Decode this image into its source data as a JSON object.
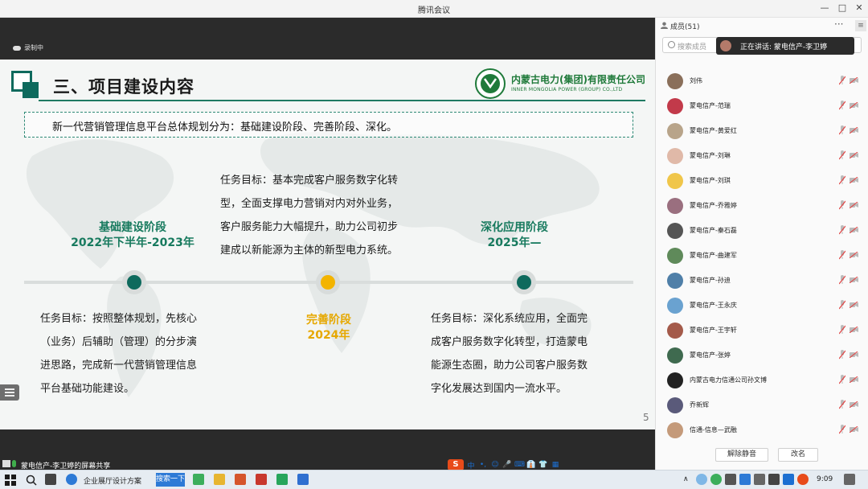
{
  "window": {
    "title": "腾讯会议",
    "controls": [
      "—",
      "□",
      "✕"
    ]
  },
  "recording": {
    "label": "录制中",
    "icon": "cloud-recording-icon"
  },
  "slide": {
    "section_title": "三、项目建设内容",
    "company_cn": "内蒙古电力(集团)有限责任公司",
    "company_en": "INNER MONGOLIA POWER (GROUP) CO.,LTD",
    "summary": "新一代营销管理信息平台总体规划分为：基础建设阶段、完善阶段、深化。",
    "stages": [
      {
        "name": "基础建设阶段",
        "period": "2022年下半年-2023年",
        "color": "#177a5e"
      },
      {
        "name": "完善阶段",
        "period": "2024年",
        "color": "#e6a800"
      },
      {
        "name": "深化应用阶段",
        "period": "2025年—",
        "color": "#177a5e"
      }
    ],
    "tasks": [
      {
        "lines": [
          "任务目标：按照整体规划，先核心",
          "（业务）后辅助（管理）的分步演",
          "进思路，完成新一代营销管理信息",
          "平台基础功能建设。"
        ]
      },
      {
        "lines": [
          "任务目标：基本完成客户服务数字化转",
          "型，全面支撑电力营销对内对外业务，",
          "客户服务能力大幅提升，助力公司初步",
          "建成以新能源为主体的新型电力系统。"
        ]
      },
      {
        "lines": [
          "任务目标：深化系统应用，全面完",
          "成客户服务数字化转型，打造蒙电",
          "能源生态圈，助力公司客户服务数",
          "字化发展达到国内一流水平。"
        ]
      }
    ],
    "page_number": "5"
  },
  "members_panel": {
    "title": "成员(51)",
    "more": "···",
    "search_placeholder": "搜索成员",
    "speaking_label": "正在讲话: 蒙电信产-李卫婷",
    "members": [
      {
        "name": "刘伟",
        "avatar_color": "#8a6f5a"
      },
      {
        "name": "蒙电信产-范瑞",
        "avatar_color": "#c23a4a"
      },
      {
        "name": "蒙电信产-黄爱红",
        "avatar_color": "#b8a48a"
      },
      {
        "name": "蒙电信产-刘琳",
        "avatar_color": "#e0b9a8"
      },
      {
        "name": "蒙电信产-刘琪",
        "avatar_color": "#f0c64a"
      },
      {
        "name": "蒙电信产-乔雅婷",
        "avatar_color": "#9a6f7f"
      },
      {
        "name": "蒙电信产-秦石磊",
        "avatar_color": "#555555"
      },
      {
        "name": "蒙电信产-曲建军",
        "avatar_color": "#5f8a5a"
      },
      {
        "name": "蒙电信产-孙迪",
        "avatar_color": "#4f7fa8"
      },
      {
        "name": "蒙电信产-王永庆",
        "avatar_color": "#6aa2d0"
      },
      {
        "name": "蒙电信产-王宇轩",
        "avatar_color": "#a45a4a"
      },
      {
        "name": "蒙电信产-张婷",
        "avatar_color": "#3f6a4f"
      },
      {
        "name": "内蒙古电力信通公司孙文博",
        "avatar_color": "#222222"
      },
      {
        "name": "乔新辉",
        "avatar_color": "#5a5a7a"
      },
      {
        "name": "信通-信息—武融",
        "avatar_color": "#c49a7a"
      }
    ],
    "mute_all": "解除静音",
    "rename": "改名"
  },
  "share_caption": "蒙电信产-李卫婷的屏幕共享",
  "ime_letter": "S",
  "ime_icons": [
    "中",
    "•,",
    "☺",
    "🎤",
    "⌨",
    "👔",
    "👕",
    "▦"
  ],
  "taskbar": {
    "browser_tab": "企业展厅设计方案",
    "search_button": "搜索一下",
    "time": "9:09"
  }
}
